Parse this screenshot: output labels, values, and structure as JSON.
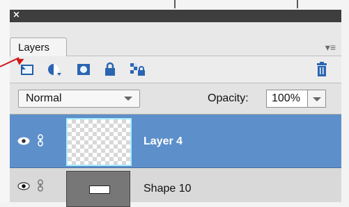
{
  "panel": {
    "close_symbol": "×",
    "tab_label": "Layers",
    "menu_symbol": "▾≡"
  },
  "toolbar": {
    "icons": [
      "new-layer-icon",
      "adjustment-layer-icon",
      "layer-mask-icon",
      "lock-all-icon",
      "lock-transparency-icon",
      "trash-icon"
    ]
  },
  "controls": {
    "blend_mode": "Normal",
    "opacity_label": "Opacity:",
    "opacity_value": "100%"
  },
  "layers": [
    {
      "name": "Layer 4",
      "selected": true
    },
    {
      "name": "Shape 10",
      "selected": false
    }
  ],
  "colors": {
    "selected_row": "#5d8fca",
    "arrow": "#d01616"
  }
}
